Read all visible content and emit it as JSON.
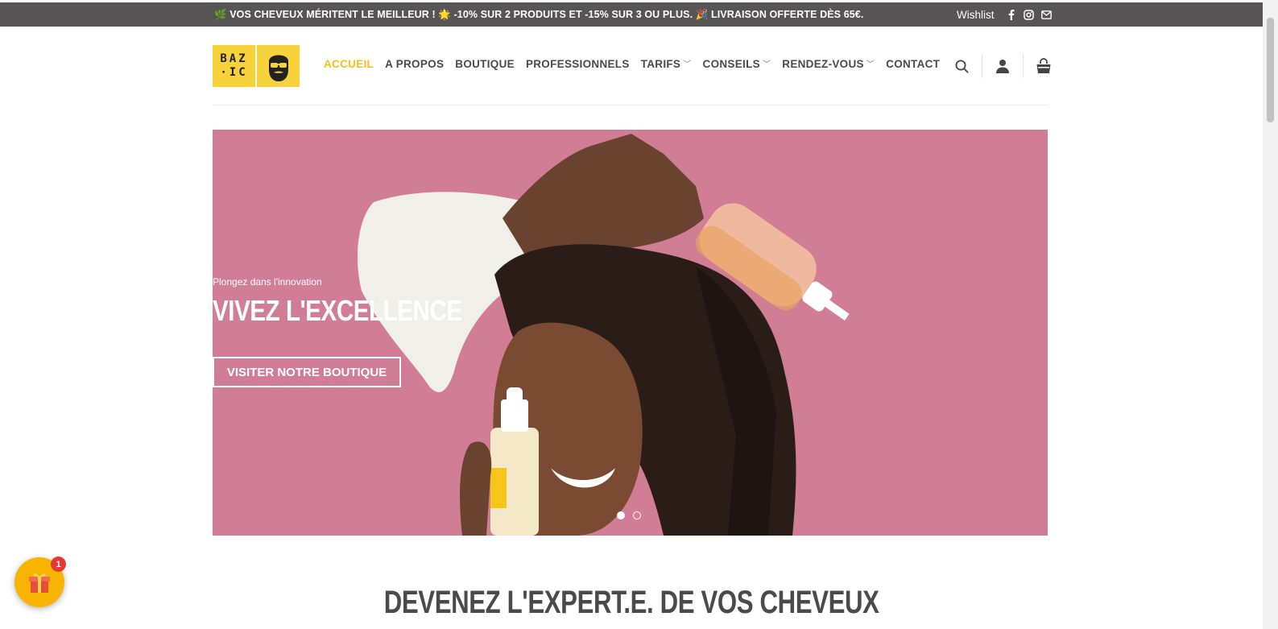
{
  "topbar": {
    "promo": "🌿 VOS CHEVEUX MÉRITENT LE MEILLEUR ! 🌟 -10% SUR 2 PRODUITS ET -15% SUR 3 OU PLUS. 🎉 LIVRAISON OFFERTE DÈS 65€.",
    "wishlist": "Wishlist",
    "social_icons": [
      "facebook-icon",
      "instagram-icon",
      "mail-icon"
    ]
  },
  "logo": {
    "text_line1": "BAZ",
    "text_line2": "·IC"
  },
  "nav": {
    "items": [
      {
        "label": "ACCUEIL",
        "active": true,
        "dropdown": false
      },
      {
        "label": "A PROPOS",
        "active": false,
        "dropdown": false
      },
      {
        "label": "BOUTIQUE",
        "active": false,
        "dropdown": false
      },
      {
        "label": "PROFESSIONNELS",
        "active": false,
        "dropdown": false
      },
      {
        "label": "TARIFS",
        "active": false,
        "dropdown": true
      },
      {
        "label": "CONSEILS",
        "active": false,
        "dropdown": true
      },
      {
        "label": "RENDEZ-VOUS",
        "active": false,
        "dropdown": true
      },
      {
        "label": "CONTACT",
        "active": false,
        "dropdown": false
      }
    ],
    "chevron": "﹀"
  },
  "header_icons": [
    "search-icon",
    "account-icon",
    "cart-icon"
  ],
  "hero": {
    "subtitle": "Plongez dans l'innovation",
    "title": "VIVEZ L'EXCELLENCE",
    "cta": "VISITER NOTRE BOUTIQUE",
    "slides": 2,
    "active_slide": 1
  },
  "section": {
    "title": "DEVENEZ L'EXPERT.E. DE VOS CHEVEUX"
  },
  "gift": {
    "icon": "gift-icon",
    "badge": "1"
  },
  "colors": {
    "accent": "#f3c11b",
    "topbar_bg": "#575456",
    "hero_bg": "#d07d95",
    "logo_bg": "#f8d23a"
  }
}
